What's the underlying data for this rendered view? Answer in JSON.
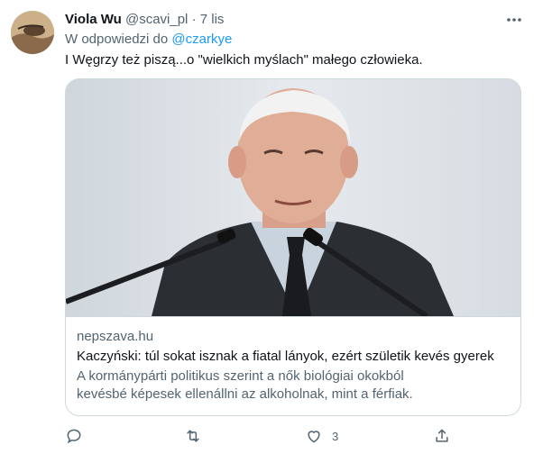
{
  "tweet": {
    "author_name": "Viola Wu",
    "author_handle": "@scavi_pl",
    "separator": "·",
    "timestamp": "7 lis",
    "reply_prefix": "W odpowiedzi do",
    "reply_mention": "@czarkye",
    "text": "I Węgrzy też piszą...o \"wielkich myślach\" małego człowieka."
  },
  "card": {
    "domain": "nepszava.hu",
    "title": "Kaczyński: túl sokat isznak a fiatal lányok, ezért születik kevés gyerek",
    "description": "A kormánypárti politikus szerint a nők biológiai okokból kevésbé képesek ellenállni az alkoholnak, mint a férfiak."
  },
  "actions": {
    "reply_icon": "reply-icon",
    "retweet_icon": "retweet-icon",
    "like_icon": "like-icon",
    "like_count": "3",
    "share_icon": "share-icon"
  },
  "colors": {
    "link": "#1d9bf0",
    "secondary_text": "#536471",
    "border": "#cfd9de"
  }
}
